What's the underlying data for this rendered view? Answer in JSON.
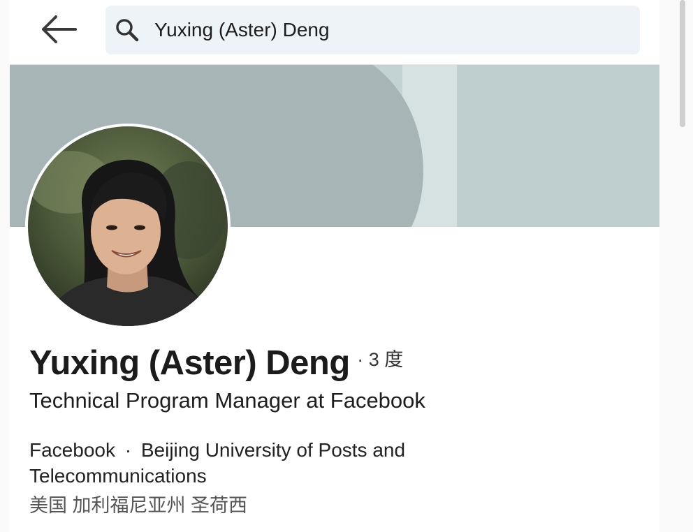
{
  "search": {
    "query": "Yuxing (Aster) Deng"
  },
  "profile": {
    "name": "Yuxing (Aster) Deng",
    "degree": "· 3 度",
    "headline": "Technical Program Manager at Facebook",
    "company": "Facebook",
    "separator": "·",
    "school": "Beijing University of Posts and Telecommunications",
    "location": "美国 加利福尼亚州 圣荷西"
  },
  "icons": {
    "back": "arrow-left-icon",
    "search": "search-icon"
  },
  "colors": {
    "cover_light": "#c3d2d3",
    "cover_dark": "#a7b5b6",
    "search_bg": "#eef3f8"
  }
}
